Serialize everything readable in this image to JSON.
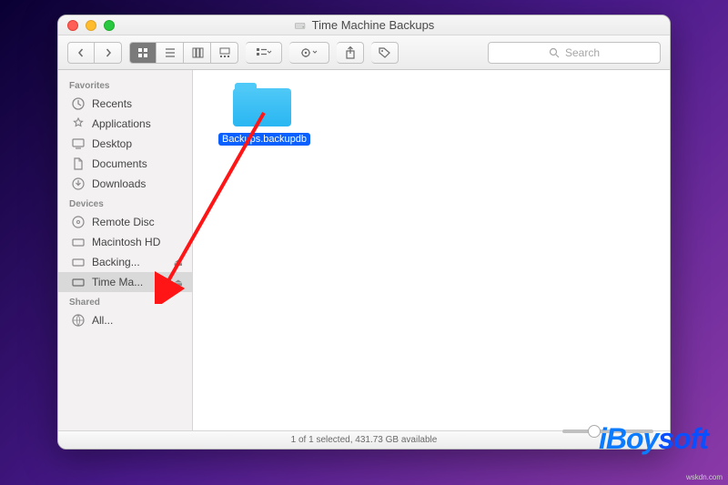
{
  "window": {
    "title": "Time Machine Backups"
  },
  "toolbar": {
    "search_placeholder": "Search"
  },
  "sidebar": {
    "sections": [
      {
        "heading": "Favorites",
        "items": [
          {
            "icon": "clock-icon",
            "label": "Recents"
          },
          {
            "icon": "app-icon",
            "label": "Applications"
          },
          {
            "icon": "desktop-icon",
            "label": "Desktop"
          },
          {
            "icon": "doc-icon",
            "label": "Documents"
          },
          {
            "icon": "download-icon",
            "label": "Downloads"
          }
        ]
      },
      {
        "heading": "Devices",
        "items": [
          {
            "icon": "disc-icon",
            "label": "Remote Disc"
          },
          {
            "icon": "drive-icon",
            "label": "Macintosh HD"
          },
          {
            "icon": "drive-icon",
            "label": "Backing...",
            "ejectable": true
          },
          {
            "icon": "drive-icon",
            "label": "Time Ma...",
            "ejectable": true,
            "active": true
          }
        ]
      },
      {
        "heading": "Shared",
        "items": [
          {
            "icon": "globe-icon",
            "label": "All..."
          }
        ]
      }
    ]
  },
  "content": {
    "items": [
      {
        "name": "Backups.backupdb",
        "selected": true
      }
    ]
  },
  "statusbar": {
    "text": "1 of 1 selected, 431.73 GB available"
  },
  "branding": {
    "name": "iBoysoft",
    "credit": "wskdn.com"
  },
  "colors": {
    "accent": "#0a60ff",
    "folder": "#29b6f2"
  }
}
